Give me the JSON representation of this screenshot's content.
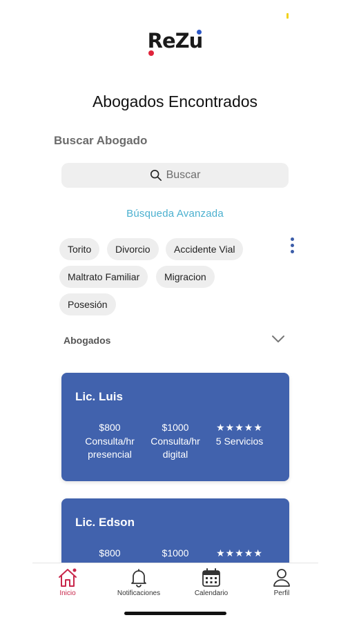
{
  "app": {
    "logo_text": "ReZu"
  },
  "header": {
    "title": "Abogados Encontrados"
  },
  "search": {
    "section_label": "Buscar Abogado",
    "placeholder": "Buscar",
    "advanced_link": "Búsqueda Avanzada"
  },
  "filters": {
    "chips": [
      "Torito",
      "Divorcio",
      "Accidente Vial",
      "Maltrato Familiar",
      "Migracion",
      "Posesión"
    ]
  },
  "list": {
    "dropdown_label": "Abogados",
    "lawyers": [
      {
        "name": "Lic. Luis",
        "price_presencial": "$800",
        "presencial_unit": "Consulta/hr",
        "presencial_label": "presencial",
        "price_digital": "$1000",
        "digital_unit": "Consulta/hr",
        "digital_label": "digital",
        "stars": "★★★★★",
        "rating": 5,
        "services": "5 Servicios"
      },
      {
        "name": "Lic. Edson",
        "price_presencial": "$800",
        "price_digital": "$1000",
        "stars": "★★★★★",
        "rating": 5
      }
    ]
  },
  "tabs": [
    {
      "label": "Inicio",
      "icon": "home-icon",
      "active": true
    },
    {
      "label": "Notificaciones",
      "icon": "bell-icon",
      "active": false
    },
    {
      "label": "Calendario",
      "icon": "calendar-icon",
      "active": false
    },
    {
      "label": "Perfil",
      "icon": "person-icon",
      "active": false
    }
  ],
  "colors": {
    "card_bg": "#4162ad",
    "accent_link": "#4bb0cf",
    "active_tab": "#c8264a",
    "logo_red": "#e0243b",
    "logo_blue": "#2d58c8"
  }
}
